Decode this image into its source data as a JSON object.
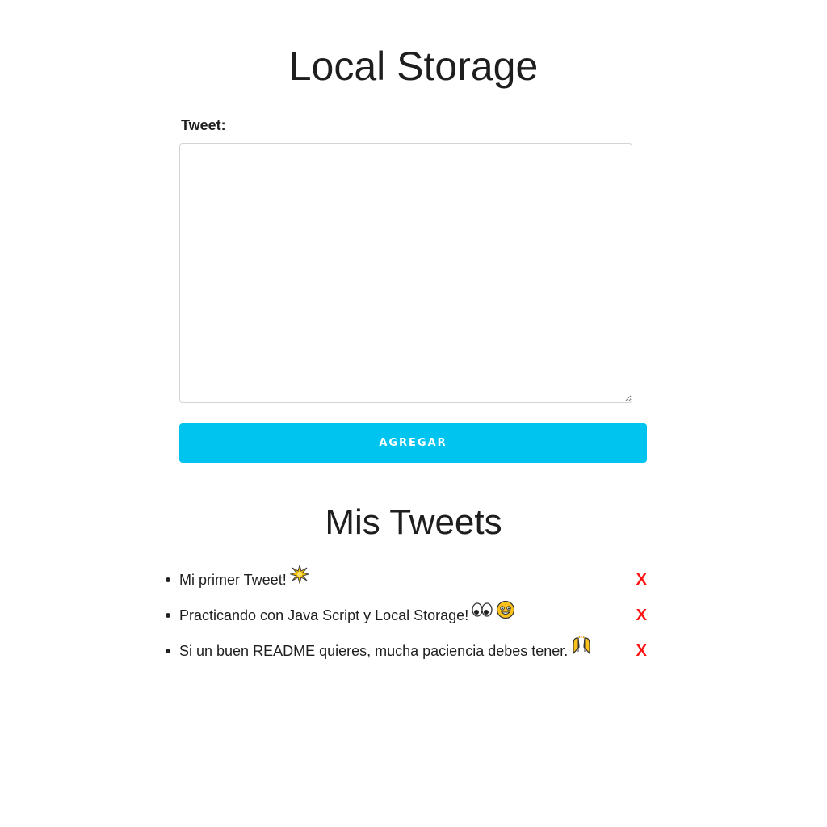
{
  "header": {
    "title": "Local Storage"
  },
  "form": {
    "label": "Tweet:",
    "textarea_value": "",
    "submit_label": "AGREGAR"
  },
  "tweets_section": {
    "title": "Mis Tweets",
    "delete_label": "X",
    "items": [
      {
        "text": "Mi primer Tweet!",
        "emojis": [
          "sparkle-burst-icon"
        ]
      },
      {
        "text": "Practicando con Java Script y Local Storage!",
        "emojis": [
          "eyes-icon",
          "grinning-face-icon"
        ]
      },
      {
        "text": "Si un buen README quieres, mucha paciencia debes tener.",
        "emojis": [
          "raising-hands-icon"
        ]
      }
    ]
  },
  "colors": {
    "accent": "#00c4f0",
    "delete": "#ff1111"
  }
}
